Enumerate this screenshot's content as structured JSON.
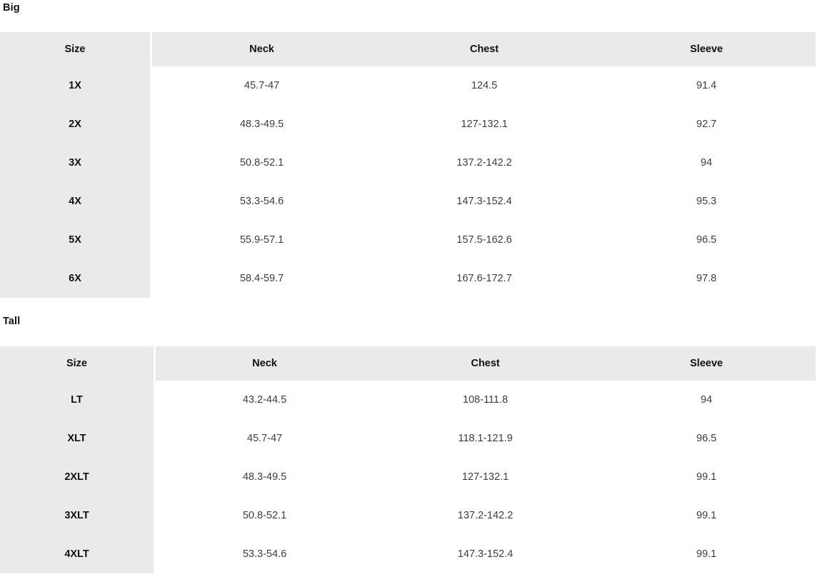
{
  "page": {
    "background_color": "#ffffff",
    "header_background_color": "#e9eaec",
    "size_column_background_color": "#e9eaec",
    "text_color": "#111111",
    "value_text_color": "#3d3d3d"
  },
  "sections": [
    {
      "id": "big",
      "title": "Big",
      "columns": [
        "Size",
        "Neck",
        "Chest",
        "Sleeve"
      ],
      "rows": [
        {
          "size": "1X",
          "neck": "45.7-47",
          "chest": "124.5",
          "sleeve": "91.4"
        },
        {
          "size": "2X",
          "neck": "48.3-49.5",
          "chest": "127-132.1",
          "sleeve": "92.7"
        },
        {
          "size": "3X",
          "neck": "50.8-52.1",
          "chest": "137.2-142.2",
          "sleeve": "94"
        },
        {
          "size": "4X",
          "neck": "53.3-54.6",
          "chest": "147.3-152.4",
          "sleeve": "95.3"
        },
        {
          "size": "5X",
          "neck": "55.9-57.1",
          "chest": "157.5-162.6",
          "sleeve": "96.5"
        },
        {
          "size": "6X",
          "neck": "58.4-59.7",
          "chest": "167.6-172.7",
          "sleeve": "97.8"
        }
      ]
    },
    {
      "id": "tall",
      "title": "Tall",
      "columns": [
        "Size",
        "Neck",
        "Chest",
        "Sleeve"
      ],
      "rows": [
        {
          "size": "LT",
          "neck": "43.2-44.5",
          "chest": "108-111.8",
          "sleeve": "94"
        },
        {
          "size": "XLT",
          "neck": "45.7-47",
          "chest": "118.1-121.9",
          "sleeve": "96.5"
        },
        {
          "size": "2XLT",
          "neck": "48.3-49.5",
          "chest": "127-132.1",
          "sleeve": "99.1"
        },
        {
          "size": "3XLT",
          "neck": "50.8-52.1",
          "chest": "137.2-142.2",
          "sleeve": "99.1"
        },
        {
          "size": "4XLT",
          "neck": "53.3-54.6",
          "chest": "147.3-152.4",
          "sleeve": "99.1"
        }
      ]
    }
  ]
}
